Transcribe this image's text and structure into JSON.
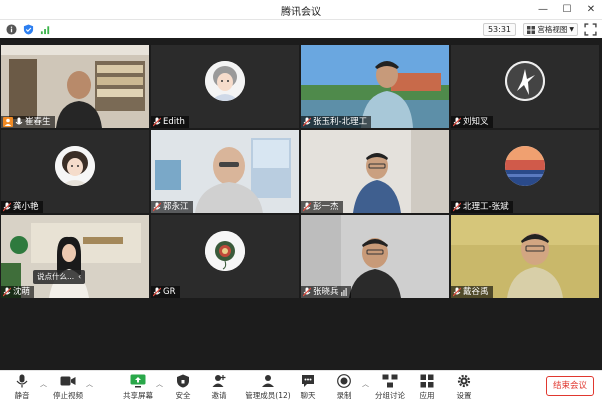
{
  "window": {
    "title": "腾讯会议"
  },
  "meeting": {
    "timer": "53:31",
    "view_label": "宫格视图"
  },
  "participants": [
    {
      "name": "崔春生",
      "muted": false,
      "host": true
    },
    {
      "name": "Edith",
      "muted": true
    },
    {
      "name": "张玉利-北理工",
      "muted": true
    },
    {
      "name": "刘知叉",
      "muted": true
    },
    {
      "name": "龚小艳",
      "muted": true
    },
    {
      "name": "郭永江",
      "muted": true
    },
    {
      "name": "彭一杰",
      "muted": true
    },
    {
      "name": "北理工-张斌",
      "muted": true
    },
    {
      "name": "沈萌",
      "muted": true,
      "tooltip": "说点什么..."
    },
    {
      "name": "GR",
      "muted": true
    },
    {
      "name": "张晓兵",
      "muted": true
    },
    {
      "name": "戴谷禹",
      "muted": true
    }
  ],
  "toolbar": {
    "mute": "静音",
    "stop_video": "停止视频",
    "share_screen": "共享屏幕",
    "security": "安全",
    "invite": "邀请",
    "manage_members": "管理成员(12)",
    "chat": "聊天",
    "record": "录制",
    "breakout": "分组讨论",
    "apps": "应用",
    "settings": "设置",
    "end_meeting": "结束会议"
  },
  "colors": {
    "accent_green": "#a6d94a",
    "end_red": "#e0382f",
    "host_orange": "#f08a24"
  }
}
